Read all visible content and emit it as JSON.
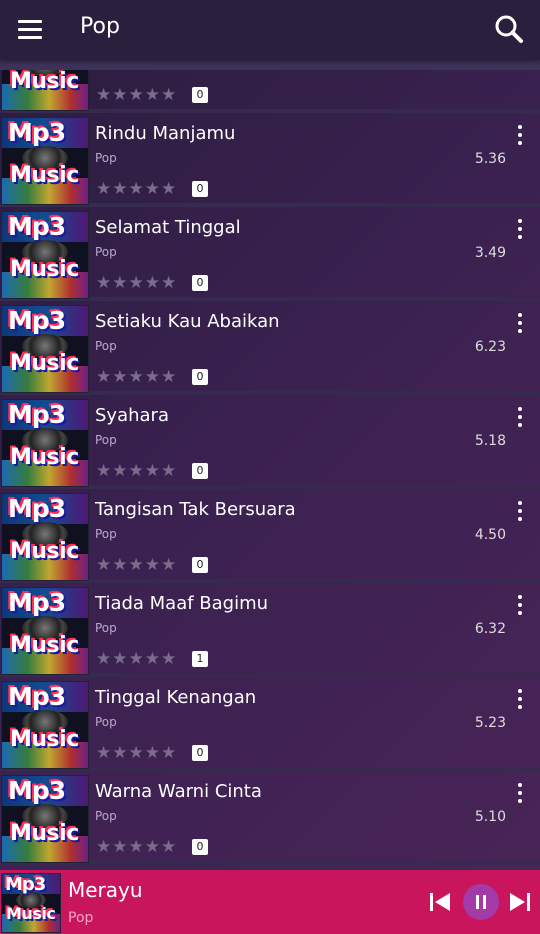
{
  "appbar": {
    "title": "Pop",
    "menu_icon": "menu-icon",
    "search_icon": "search-icon"
  },
  "partial_row": {
    "count": "0"
  },
  "rows": [
    {
      "title": "Rindu Manjamu",
      "genre": "Pop",
      "duration": "5.36",
      "count": "0"
    },
    {
      "title": "Selamat Tinggal",
      "genre": "Pop",
      "duration": "3.49",
      "count": "0"
    },
    {
      "title": "Setiaku Kau Abaikan",
      "genre": "Pop",
      "duration": "6.23",
      "count": "0"
    },
    {
      "title": "Syahara",
      "genre": "Pop",
      "duration": "5.18",
      "count": "0"
    },
    {
      "title": "Tangisan Tak Bersuara",
      "genre": "Pop",
      "duration": "4.50",
      "count": "0"
    },
    {
      "title": "Tiada Maaf Bagimu",
      "genre": "Pop",
      "duration": "6.32",
      "count": "1"
    },
    {
      "title": "Tinggal Kenangan",
      "genre": "Pop",
      "duration": "5.23",
      "count": "0"
    },
    {
      "title": "Warna Warni Cinta",
      "genre": "Pop",
      "duration": "5.10",
      "count": "0"
    }
  ],
  "thumbnail": {
    "line1": "Mp3",
    "line2": "Music"
  },
  "stars": "★★★★★",
  "player": {
    "title": "Merayu",
    "genre": "Pop",
    "state": "playing"
  },
  "colors": {
    "background": "#2a1d3d",
    "appbar": "#2b1f3e",
    "player": "#c8155c",
    "play_button": "#a23aa8"
  }
}
